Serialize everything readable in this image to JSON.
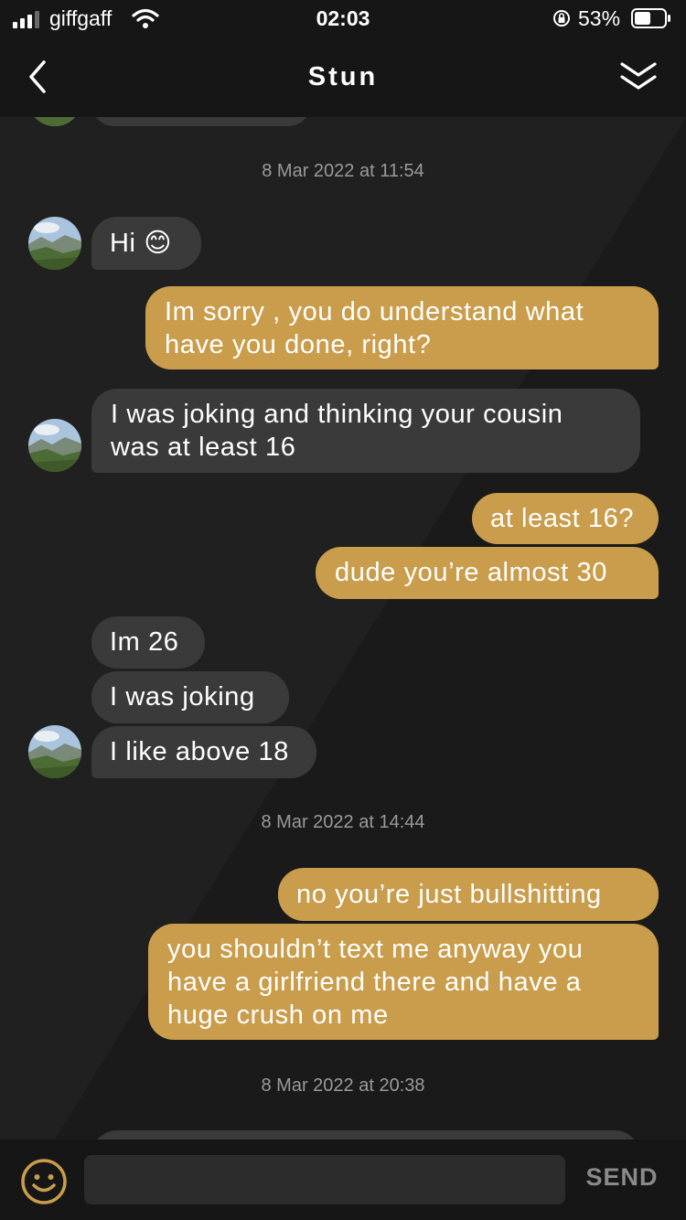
{
  "status_bar": {
    "carrier": "giffgaff",
    "time": "02:03",
    "battery": "53%"
  },
  "header": {
    "title": "Stun",
    "icons": [
      "chevron-left-icon",
      "double-chevron-down-icon"
    ]
  },
  "timestamps": [
    "8 Mar 2022 at 11:54",
    "8 Mar 2022 at 14:44",
    "8 Mar 2022 at 20:38"
  ],
  "messages": [
    {
      "from": "them",
      "lines": [
        "Hi 😊"
      ]
    },
    {
      "from": "me",
      "lines": [
        "Im sorry , you do understand what",
        "have you done, right?"
      ]
    },
    {
      "from": "them",
      "lines": [
        "I was joking and thinking your cousin",
        "was at least 16"
      ]
    },
    {
      "from": "me",
      "lines": [
        "at least 16?"
      ]
    },
    {
      "from": "me",
      "lines": [
        "dude you’re almost 30"
      ]
    },
    {
      "from": "them",
      "lines": [
        "Im 26"
      ]
    },
    {
      "from": "them",
      "lines": [
        "I was joking"
      ]
    },
    {
      "from": "them",
      "lines": [
        "I like above 18"
      ]
    },
    {
      "from": "me",
      "lines": [
        "no you’re just bullshitting"
      ]
    },
    {
      "from": "me",
      "lines": [
        "you shouldn’t text me anyway you",
        "have a girlfriend there and have a",
        "huge crush on me"
      ]
    }
  ],
  "composer": {
    "placeholder": "",
    "send_label": "SEND",
    "emoji_icon": "smiley-icon"
  },
  "colors": {
    "outgoing": "#c99d4b",
    "incoming": "#3a3a3a",
    "background": "#202020",
    "bar": "#161616"
  }
}
